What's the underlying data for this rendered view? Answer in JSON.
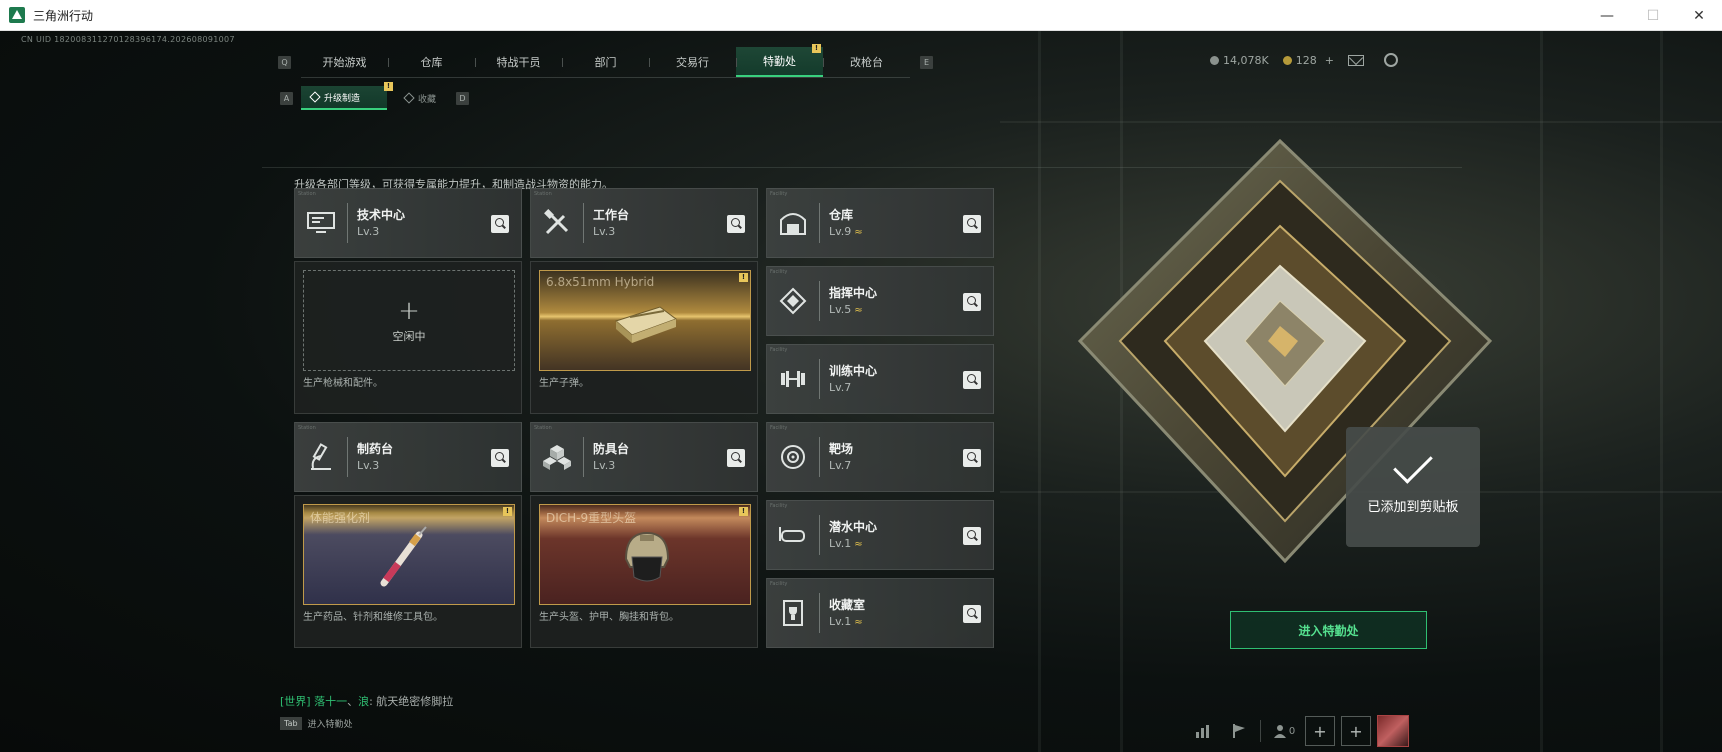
{
  "window": {
    "title": "三角洲行动",
    "minimize": "—",
    "maximize": "☐",
    "close": "✕"
  },
  "uid": "CN UID 182008311270128396174.202608091007",
  "nav": {
    "left_key": "Q",
    "right_key": "E",
    "tabs": [
      {
        "label": "开始游戏"
      },
      {
        "label": "仓库"
      },
      {
        "label": "特战干员"
      },
      {
        "label": "部门"
      },
      {
        "label": "交易行"
      },
      {
        "label": "特勤处",
        "active": true,
        "badge": "!"
      },
      {
        "label": "改枪台"
      }
    ]
  },
  "currency": {
    "silver": "14,078K",
    "gold": "128",
    "gold_plus": "+"
  },
  "subnav": {
    "left_key": "A",
    "right_key": "D",
    "tabs": [
      {
        "label": "升级制造",
        "active": true,
        "badge": "!"
      },
      {
        "label": "收藏"
      }
    ]
  },
  "description": "升级各部门等级，可获得专属能力提升，和制造战斗物资的能力。",
  "stations": {
    "tech": {
      "name": "技术中心",
      "lv": "Lv.3",
      "icon": "computer-icon",
      "mini": "Station",
      "idle": "空闲中",
      "plus": "+",
      "caption": "生产枪械和配件。"
    },
    "workbench": {
      "name": "工作台",
      "lv": "Lv.3",
      "icon": "tools-icon",
      "mini": "Station",
      "item": "6.8x51mm Hybrid",
      "badge": "!",
      "caption": "生产子弹。"
    },
    "pharmacy": {
      "name": "制药台",
      "lv": "Lv.3",
      "icon": "microscope-icon",
      "mini": "Station",
      "item": "体能强化剂",
      "badge": "!",
      "caption": "生产药品、针剂和维修工具包。"
    },
    "armor": {
      "name": "防具台",
      "lv": "Lv.3",
      "icon": "cubes-icon",
      "mini": "Station",
      "item": "DICH-9重型头盔",
      "badge": "!",
      "caption": "生产头盔、护甲、胸挂和背包。"
    }
  },
  "facilities": [
    {
      "name": "仓库",
      "lv": "Lv.9",
      "upgrade": true,
      "icon": "warehouse-icon",
      "mini": "Facility"
    },
    {
      "name": "指挥中心",
      "lv": "Lv.5",
      "upgrade": true,
      "icon": "command-icon",
      "mini": "Facility"
    },
    {
      "name": "训练中心",
      "lv": "Lv.7",
      "upgrade": false,
      "icon": "dumbbell-icon",
      "mini": "Facility"
    },
    {
      "name": "靶场",
      "lv": "Lv.7",
      "upgrade": false,
      "icon": "target-icon",
      "mini": "Facility"
    },
    {
      "name": "潜水中心",
      "lv": "Lv.1",
      "upgrade": true,
      "icon": "goggles-icon",
      "mini": "Facility"
    },
    {
      "name": "收藏室",
      "lv": "Lv.1",
      "upgrade": true,
      "icon": "trophy-case-icon",
      "mini": "Facility"
    }
  ],
  "upgrade_mark": "≈",
  "toast": {
    "text": "已添加到剪贴板"
  },
  "enter_button": "进入特勤处",
  "chat": {
    "channel": "[世界]",
    "name": "落十一",
    "sep": "、",
    "name2": "浪",
    "message": "航天绝密修脚拉"
  },
  "tab_hint": {
    "key": "Tab",
    "label": "进入特勤处"
  },
  "bottom": {
    "friends": "0",
    "plus1": "+",
    "plus2": "+"
  },
  "colors": {
    "accent": "#39d07e",
    "badge": "#e8c65a",
    "upgrade": "#e2c14e"
  }
}
